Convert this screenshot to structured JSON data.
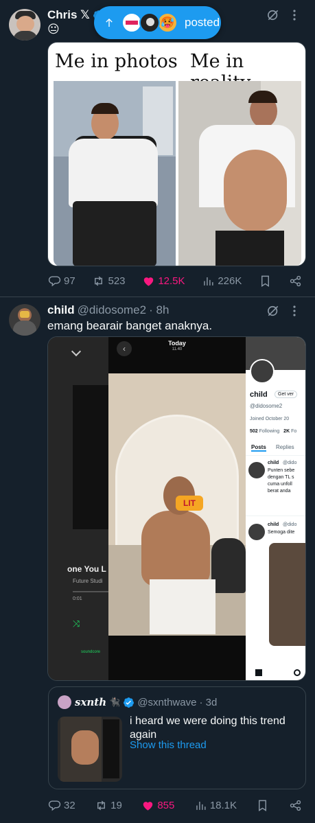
{
  "tweet1": {
    "name": "Chris 𝕏",
    "status_emoji": "😐",
    "posted_label": "posted",
    "meme_left": "Me in photos",
    "meme_right": "Me in reality",
    "replies": "97",
    "retweets": "523",
    "likes": "12.5K",
    "views": "226K"
  },
  "tweet2": {
    "name": "child",
    "handle": "@didosome2",
    "time": "· 8h",
    "text": "emang bearair banget anaknya.",
    "screenshot": {
      "player_song": "one You L",
      "player_artist": "Future Studi",
      "player_time": "0:01",
      "player_service": "soundcore",
      "story_date": "Today",
      "story_time": "11.40",
      "lit_sticker": "LIT",
      "profile_name": "child",
      "profile_handle": "@didosome2",
      "get_verified": "Get ver",
      "joined": "Joined October 20",
      "following_count": "502",
      "following_label": "Following",
      "followers_count": "2K",
      "followers_label": "Fo",
      "tab_posts": "Posts",
      "tab_replies": "Replies",
      "reply1_name": "child",
      "reply1_handle": "@dido",
      "reply1_lines": [
        "Punten sebe",
        "dengan TL s",
        "cuma unfoll",
        "berat anda"
      ],
      "reply2_name": "child",
      "reply2_handle": "@dido",
      "reply2_line": "Semoga dite"
    },
    "quote": {
      "name": "sxnth",
      "emoji": "🐈‍⬛",
      "handle": "@sxnthwave",
      "time": "· 3d",
      "text": "i heard we were doing this trend again",
      "link": "Show this thread"
    },
    "replies": "32",
    "retweets": "19",
    "likes": "855",
    "views": "18.1K"
  },
  "colors": {
    "background": "#15202b",
    "accent": "#1d9bf0",
    "like": "#f91880",
    "muted": "#8b98a5",
    "border": "#38444d"
  },
  "icons": [
    "grok-icon",
    "more-icon",
    "reply-icon",
    "retweet-icon",
    "heart-icon",
    "views-icon",
    "bookmark-icon",
    "share-icon",
    "verified-icon",
    "arrow-up-icon"
  ]
}
